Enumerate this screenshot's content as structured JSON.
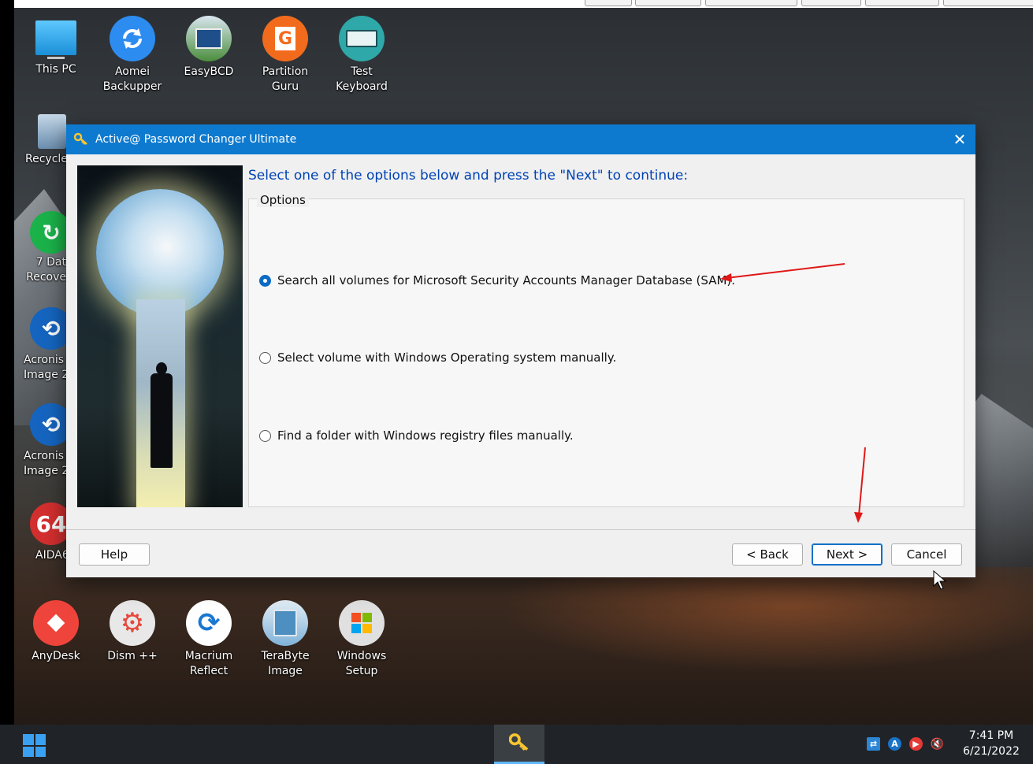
{
  "desktop": {
    "icons": [
      {
        "label": "This PC",
        "icon": "monitor-icon",
        "color": "#1da1f2"
      },
      {
        "label": "Aomei Backupper",
        "icon": "sync-icon",
        "color": "#2d8cf0"
      },
      {
        "label": "EasyBCD",
        "icon": "computer-icon",
        "color": "#4a8d3c"
      },
      {
        "label": "Partition Guru",
        "icon": "partition-icon",
        "color": "#f26b1d"
      },
      {
        "label": "Test Keyboard",
        "icon": "keyboard-icon",
        "color": "#2ea8a8"
      },
      {
        "label": "Recycle",
        "icon": "recycle-bin-icon",
        "color": "#6c8fb0"
      },
      {
        "label": "7 Dat Recove",
        "icon": "recovery-icon",
        "color": "#1bb24a"
      },
      {
        "label": "Acronis Image 2",
        "icon": "acronis-icon",
        "color": "#1565c0"
      },
      {
        "label": "Acronis Image 2",
        "icon": "acronis-icon",
        "color": "#1565c0"
      },
      {
        "label": "AIDA6",
        "icon": "aida64-icon",
        "color": "#d32f2f"
      },
      {
        "label": "AnyDesk",
        "icon": "anydesk-icon",
        "color": "#ef443b"
      },
      {
        "label": "Dism ++",
        "icon": "gear-icon",
        "color": "#e64a3c"
      },
      {
        "label": "Macrium Reflect",
        "icon": "macrium-icon",
        "color": "#1976d2"
      },
      {
        "label": "TeraByte Image",
        "icon": "terabyte-icon",
        "color": "#7fb2d8"
      },
      {
        "label": "Windows Setup",
        "icon": "windows-setup-icon",
        "color": "#e0e0e0"
      }
    ]
  },
  "dialog": {
    "title": "Active@ Password Changer Ultimate",
    "title_icon": "key-icon",
    "close_icon": "close-icon",
    "instruction": "Select one of the options below and press the \"Next\" to continue:",
    "options_legend": "Options",
    "options": [
      {
        "label": "Search all volumes for Microsoft Security Accounts Manager Database (SAM).",
        "selected": true
      },
      {
        "label": "Select volume with Windows Operating system manually.",
        "selected": false
      },
      {
        "label": "Find a folder with Windows registry files manually.",
        "selected": false
      }
    ],
    "buttons": {
      "help": "Help",
      "back": "< Back",
      "next": "Next >",
      "cancel": "Cancel"
    }
  },
  "taskbar": {
    "start_icon": "windows-start-icon",
    "active_app_icon": "key-icon",
    "tray_icons": [
      "network-icon",
      "a-icon",
      "record-icon",
      "speaker-muted-icon"
    ],
    "time": "7:41 PM",
    "date": "6/21/2022"
  },
  "colors": {
    "titlebar": "#0e7acf",
    "instruction": "#0043b5",
    "annotation_arrow": "#e01818"
  }
}
